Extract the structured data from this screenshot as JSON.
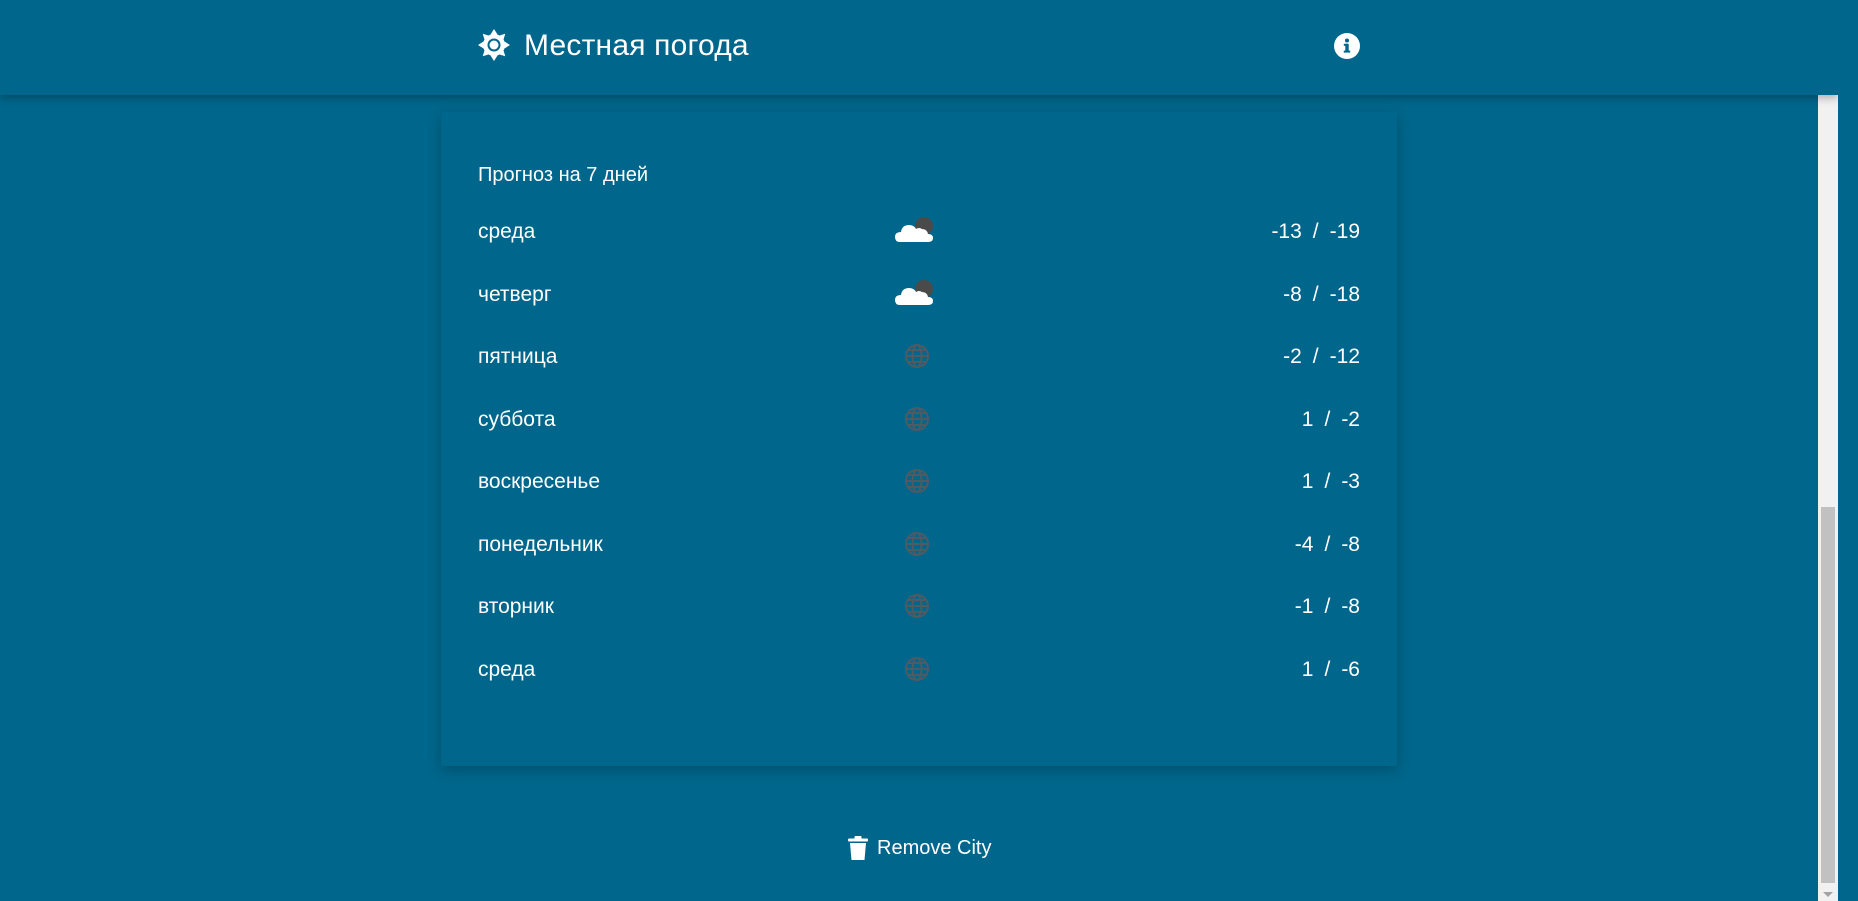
{
  "header": {
    "title": "Местная погода",
    "brand_icon": "sun-gear-icon",
    "info_icon": "info-icon"
  },
  "forecast": {
    "title": "Прогноз на 7 дней",
    "days": [
      {
        "day": "среда",
        "icon": "cloud-night-icon",
        "high": "-13",
        "low": "-19"
      },
      {
        "day": "четверг",
        "icon": "cloud-night-icon",
        "high": "-8",
        "low": "-18"
      },
      {
        "day": "пятница",
        "icon": "globe-icon",
        "high": "-2",
        "low": "-12"
      },
      {
        "day": "суббота",
        "icon": "globe-icon",
        "high": "1",
        "low": "-2"
      },
      {
        "day": "воскресенье",
        "icon": "globe-icon",
        "high": "1",
        "low": "-3"
      },
      {
        "day": "понедельник",
        "icon": "globe-icon",
        "high": "-4",
        "low": "-8"
      },
      {
        "day": "вторник",
        "icon": "globe-icon",
        "high": "-1",
        "low": "-8"
      },
      {
        "day": "среда",
        "icon": "globe-icon",
        "high": "1",
        "low": "-6"
      }
    ],
    "separator": "/"
  },
  "actions": {
    "remove_label": "Remove City",
    "remove_icon": "trash-icon"
  },
  "colors": {
    "background": "#00668b",
    "text": "#ffffff",
    "icon_muted": "#4f5b63"
  }
}
